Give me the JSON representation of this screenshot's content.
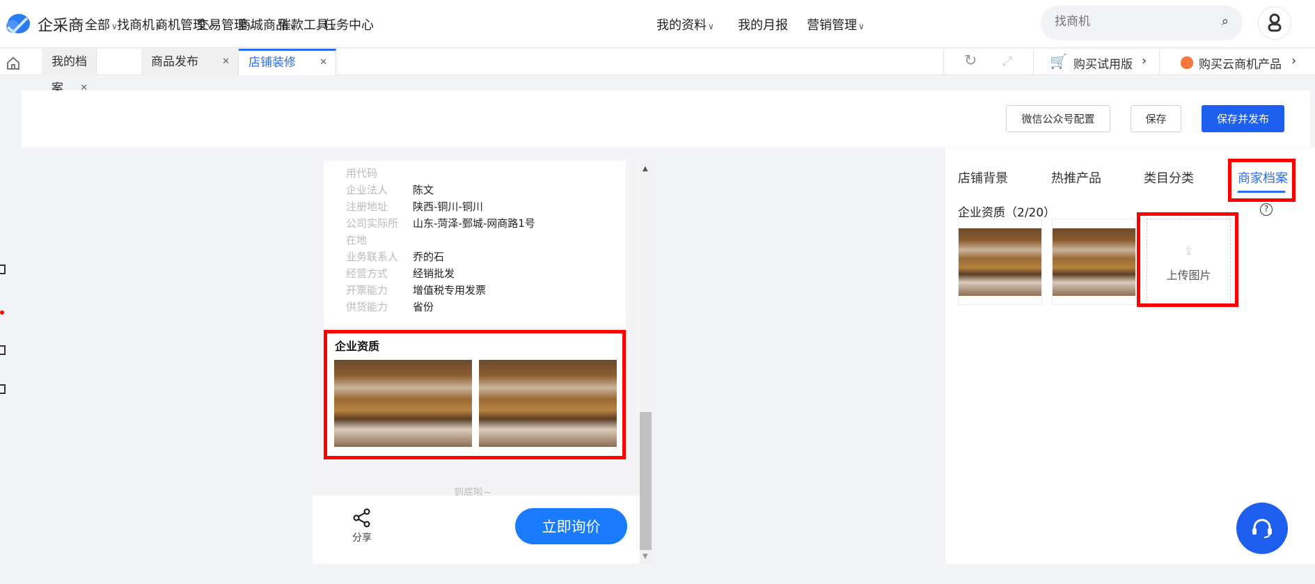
{
  "header": {
    "brand": "企采商",
    "all": "全部",
    "nav": [
      "找商机",
      "商机管理",
      "交易管理",
      "商城商品",
      "催款工具",
      "任务中心",
      "我的资料",
      "我的月报",
      "营销管理"
    ],
    "search_placeholder": "找商机"
  },
  "tabs": [
    {
      "label": "我的档案"
    },
    {
      "label": "商品发布"
    },
    {
      "label": "店铺装修"
    }
  ],
  "tabbar_right": {
    "trial": "购买试用版",
    "product": "购买云商机产品"
  },
  "toolbar": {
    "wechat": "微信公众号配置",
    "save": "保存",
    "save_publish": "保存并发布"
  },
  "preview": {
    "rows": [
      {
        "label": "用代码",
        "value": ""
      },
      {
        "label": "企业法人",
        "value": "陈文"
      },
      {
        "label": "注册地址",
        "value": "陕西-铜川-铜川"
      },
      {
        "label": "公司实际所",
        "value": "山东-菏泽-鄄城-网商路1号"
      },
      {
        "label": "在地",
        "value": ""
      },
      {
        "label": "业务联系人",
        "value": "乔的石"
      },
      {
        "label": "经营方式",
        "value": "经销批发"
      },
      {
        "label": "开票能力",
        "value": "增值税专用发票"
      },
      {
        "label": "供货能力",
        "value": "省份"
      }
    ],
    "section_title": "企业资质",
    "end_text": "到底啦~",
    "share": "分享",
    "inquiry": "立即询价"
  },
  "panel": {
    "tabs": [
      "店铺背景",
      "热推产品",
      "类目分类",
      "商家档案"
    ],
    "qual_title": "企业资质（2/20）",
    "upload": "上传图片"
  },
  "colors": {
    "accent": "#2c6df5",
    "primary_button": "#1f5ff0",
    "inquiry": "#1b7bff",
    "highlight": "#ff0000"
  }
}
